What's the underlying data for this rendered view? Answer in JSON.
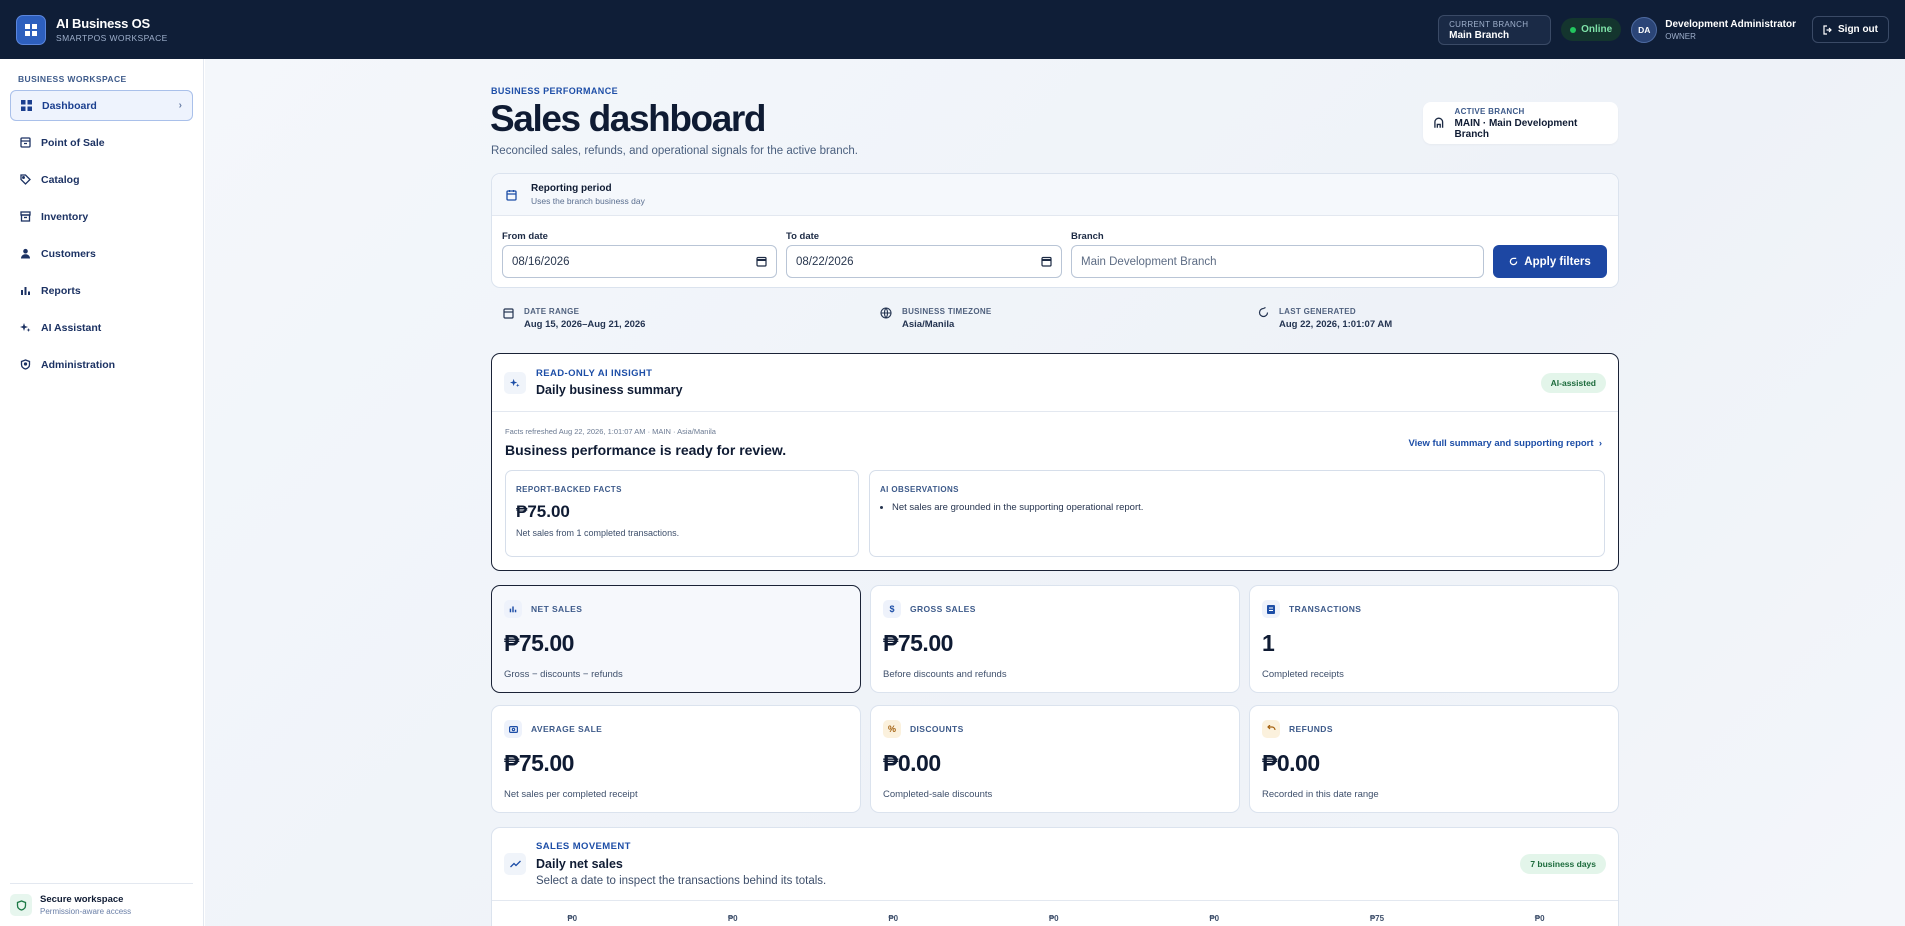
{
  "topbar": {
    "app_name": "AI Business OS",
    "workspace": "SMARTPOS WORKSPACE",
    "current_branch_label": "CURRENT BRANCH",
    "current_branch_value": "Main Branch",
    "status": "Online",
    "user_initials": "DA",
    "user_name": "Development Administrator",
    "user_role": "OWNER",
    "signout": "Sign out"
  },
  "sidebar": {
    "heading": "BUSINESS WORKSPACE",
    "items": [
      {
        "label": "Dashboard",
        "icon": "grid-icon"
      },
      {
        "label": "Point of Sale",
        "icon": "register-icon"
      },
      {
        "label": "Catalog",
        "icon": "tag-icon"
      },
      {
        "label": "Inventory",
        "icon": "box-icon"
      },
      {
        "label": "Customers",
        "icon": "user-icon"
      },
      {
        "label": "Reports",
        "icon": "bars-icon"
      },
      {
        "label": "AI Assistant",
        "icon": "sparkle-icon"
      },
      {
        "label": "Administration",
        "icon": "shield-icon"
      }
    ],
    "secure_title": "Secure workspace",
    "secure_sub": "Permission-aware access"
  },
  "header": {
    "kicker": "BUSINESS PERFORMANCE",
    "title": "Sales dashboard",
    "subtitle": "Reconciled sales, refunds, and operational signals for the active branch.",
    "active_branch_label": "ACTIVE BRANCH",
    "active_branch_value": "MAIN · Main Development Branch"
  },
  "filters": {
    "title": "Reporting period",
    "subtitle": "Uses the branch business day",
    "from_label": "From date",
    "from_value": "08/16/2026",
    "to_label": "To date",
    "to_value": "08/22/2026",
    "branch_label": "Branch",
    "branch_placeholder": "Main Development Branch",
    "apply": "Apply filters"
  },
  "meta": {
    "range_label": "DATE RANGE",
    "range_value": "Aug 15, 2026–Aug 21, 2026",
    "tz_label": "BUSINESS TIMEZONE",
    "tz_value": "Asia/Manila",
    "gen_label": "LAST GENERATED",
    "gen_value": "Aug 22, 2026, 1:01:07 AM"
  },
  "ai": {
    "kicker": "READ-ONLY AI INSIGHT",
    "title": "Daily business summary",
    "badge": "AI-assisted",
    "facts": "Facts refreshed Aug 22, 2026, 1:01:07 AM · MAIN · Asia/Manila",
    "headline": "Business performance is ready for review.",
    "link": "View full summary and supporting report",
    "facts_label": "REPORT-BACKED FACTS",
    "facts_amount": "₱75.00",
    "facts_desc": "Net sales from 1 completed transactions.",
    "obs_label": "AI OBSERVATIONS",
    "obs_item": "Net sales are grounded in the supporting operational report."
  },
  "kpis": [
    {
      "label": "NET SALES",
      "value": "₱75.00",
      "desc": "Gross − discounts − refunds"
    },
    {
      "label": "GROSS SALES",
      "value": "₱75.00",
      "desc": "Before discounts and refunds"
    },
    {
      "label": "TRANSACTIONS",
      "value": "1",
      "desc": "Completed receipts"
    },
    {
      "label": "AVERAGE SALE",
      "value": "₱75.00",
      "desc": "Net sales per completed receipt"
    },
    {
      "label": "DISCOUNTS",
      "value": "₱0.00",
      "desc": "Completed-sale discounts"
    },
    {
      "label": "REFUNDS",
      "value": "₱0.00",
      "desc": "Recorded in this date range"
    }
  ],
  "movement": {
    "kicker": "SALES MOVEMENT",
    "title": "Daily net sales",
    "subtitle": "Select a date to inspect the transactions behind its totals.",
    "badge": "7 business days",
    "bar_labels": [
      "₱0",
      "₱0",
      "₱0",
      "₱0",
      "₱0",
      "₱75",
      "₱0"
    ]
  }
}
